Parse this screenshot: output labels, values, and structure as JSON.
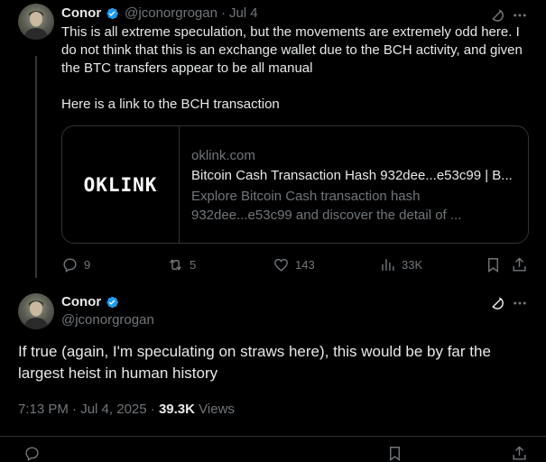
{
  "reply": {
    "author_name": "Conor",
    "handle": "@jconorgrogan",
    "separator": "·",
    "date": "Jul 4",
    "text": "This is all extreme speculation,  but the movements are extremely odd here. I do not think that this is an exchange wallet due to the BCH activity, and given the BTC transfers appear to be all manual\n\nHere is a link to the BCH transaction",
    "card": {
      "logo_text": "OKLINK",
      "domain": "oklink.com",
      "title": "Bitcoin Cash Transaction Hash 932dee...e53c99 | B...",
      "description": "Explore Bitcoin Cash transaction hash 932dee...e53c99 and discover the detail of ..."
    },
    "actions": {
      "replies": "9",
      "reposts": "5",
      "likes": "143",
      "views": "33K"
    }
  },
  "main_tweet": {
    "author_name": "Conor",
    "handle": "@jconorgrogan",
    "text": "If true (again, I'm speculating on straws here), this would be by far the largest heist in human history",
    "time": "7:13 PM",
    "separator": "·",
    "date": "Jul 4, 2025",
    "dot": "·",
    "views_count": "39.3K",
    "views_label": "Views"
  },
  "colors": {
    "background": "#000000",
    "text": "#e7e9ea",
    "secondary": "#71767b",
    "verified_blue": "#1d9bf0",
    "border": "#2f3336"
  }
}
